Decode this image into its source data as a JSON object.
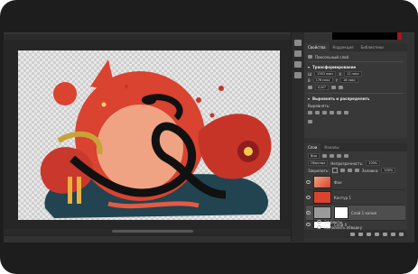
{
  "properties": {
    "tabs": [
      "Свойства",
      "Коррекция",
      "Библиотеки"
    ],
    "active_tab": 0,
    "kind": "Пиксельный слой",
    "transform_title": "Трансформирование",
    "w_value": "1553 пикс",
    "h_value": "11 пикс",
    "x_value": "176 пикс",
    "y_value": "16 пикс",
    "angle_value": "0,00°",
    "align_title": "Выровнять и распределить",
    "align_label": "Выровнять:"
  },
  "layers": {
    "tabs": [
      "Слои",
      "Каналы"
    ],
    "active_tab": 0,
    "filter_label": "Вид",
    "blend_mode": "Обычные",
    "opacity_label": "Непрозрачность:",
    "opacity_value": "100%",
    "lock_label": "Закрепить:",
    "fill_label": "Заливка:",
    "fill_value": "100%",
    "items": [
      {
        "name": "Фон",
        "selected": false
      },
      {
        "name": "Контур 1",
        "selected": false
      },
      {
        "name": "Слой 1 копия",
        "selected": true
      },
      {
        "name": "Слой 0",
        "selected": false
      }
    ],
    "effects_label": "Эффекты",
    "effect_item": "Выполнить обводку"
  },
  "colors": {
    "artwork_red": "#d9432f",
    "artwork_peach": "#f0a383",
    "artwork_teal": "#214450",
    "artwork_black": "#111111",
    "accent_red": "#b3121b"
  }
}
